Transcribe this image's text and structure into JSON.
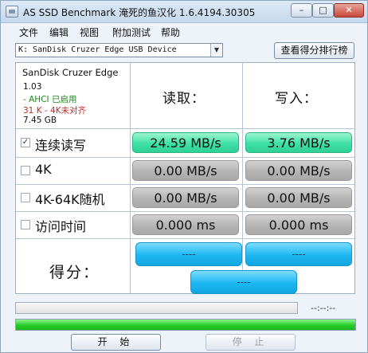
{
  "window": {
    "title": "AS SSD Benchmark 淹死的鱼汉化 1.6.4194.30305",
    "minimize_glyph": "–",
    "maximize_glyph": "□",
    "close_glyph": "✕"
  },
  "menu": {
    "items": [
      "文件",
      "编辑",
      "视图",
      "附加测试",
      "帮助"
    ]
  },
  "device": {
    "selected": "K: SanDisk Cruzer Edge USB Device",
    "ranking_button": "查看得分排行榜"
  },
  "info": {
    "name": "SanDisk Cruzer Edge",
    "firmware": "1.03",
    "ahci": "- AHCI 已启用",
    "ahci_color": "#1f8a1f",
    "alignment": "31 K - 4K未对齐",
    "alignment_color": "#c62828",
    "size": "7.45 GB"
  },
  "columns": {
    "read": "读取：",
    "write": "写入："
  },
  "tests": [
    {
      "label": "连续读写",
      "checked": true,
      "check_glyph": "✓",
      "read": "24.59 MB/s",
      "write": "3.76 MB/s",
      "state": "done"
    },
    {
      "label": "4K",
      "checked": false,
      "check_glyph": "",
      "read": "0.00 MB/s",
      "write": "0.00 MB/s",
      "state": "idle"
    },
    {
      "label": "4K-64K随机",
      "checked": false,
      "check_glyph": "",
      "read": "0.00 MB/s",
      "write": "0.00 MB/s",
      "state": "idle"
    },
    {
      "label": "访问时间",
      "checked": false,
      "check_glyph": "",
      "read": "0.000 ms",
      "write": "0.000 ms",
      "state": "idle"
    }
  ],
  "score": {
    "label": "得分：",
    "read": "----",
    "write": "----",
    "total": "----"
  },
  "status": {
    "time": "--:--:--",
    "progress_fraction": 1.0
  },
  "buttons": {
    "start": "开 始",
    "stop": "停 止"
  },
  "colors": {
    "green": "#3fe1a8",
    "gray": "#b4b4b4",
    "blue": "#1cb7f2",
    "progress": "#27cd27"
  }
}
